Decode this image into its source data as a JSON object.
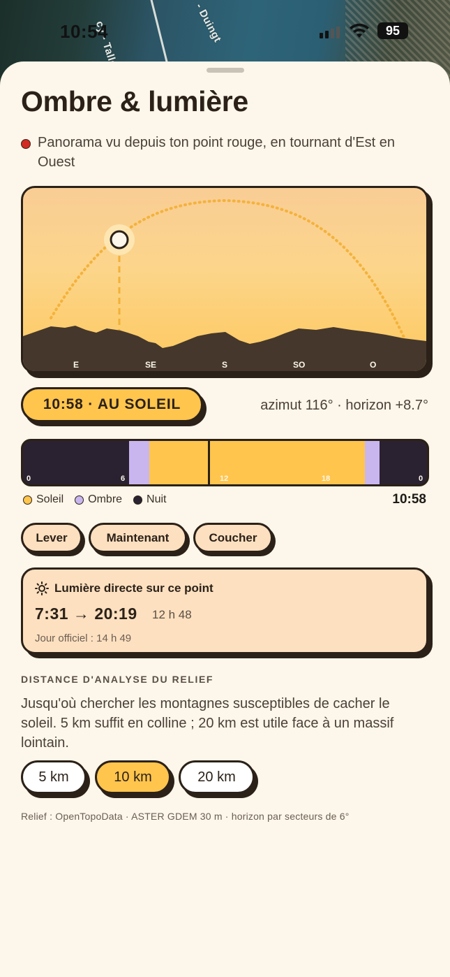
{
  "status_bar": {
    "time": "10:54",
    "battery": "95"
  },
  "map": {
    "road_labels": [
      "cy - Talloir",
      "- Duingt"
    ]
  },
  "sheet": {
    "title": "Ombre & lumière",
    "subtitle": "Panorama vu depuis ton point rouge, en tournant d'Est en Ouest"
  },
  "panorama": {
    "compass": [
      "E",
      "SE",
      "S",
      "SO",
      "O"
    ],
    "sun_azimuth_deg": 116
  },
  "current": {
    "status_label": "10:58 · AU SOLEIL",
    "azimut_text": "azimut 116° · horizon +8.7°"
  },
  "day_timeline": {
    "ticks": [
      "0",
      "6",
      "12",
      "18",
      "0"
    ],
    "segments": [
      {
        "kind": "nuit",
        "from_h": 0,
        "to_h": 6.3
      },
      {
        "kind": "ombre",
        "from_h": 6.3,
        "to_h": 7.5
      },
      {
        "kind": "soleil",
        "from_h": 7.5,
        "to_h": 20.3
      },
      {
        "kind": "ombre",
        "from_h": 20.3,
        "to_h": 21.2
      },
      {
        "kind": "nuit",
        "from_h": 21.2,
        "to_h": 24
      }
    ],
    "now_h": 10.97,
    "colors": {
      "soleil": "#ffc54d",
      "ombre": "#c9b6ef",
      "nuit": "#2a2230"
    }
  },
  "legend": {
    "sun": "Soleil",
    "shade": "Ombre",
    "night": "Nuit",
    "time": "10:58"
  },
  "quick_buttons": {
    "sunrise": "Lever",
    "now": "Maintenant",
    "sunset": "Coucher"
  },
  "light_card": {
    "title": "Lumière directe sur ce point",
    "times": "7:31 → 20:19",
    "duration": "12 h 48",
    "official": "Jour officiel : 14 h 49"
  },
  "relief": {
    "section_title": "DISTANCE D'ANALYSE DU RELIEF",
    "description": "Jusqu'où chercher les montagnes susceptibles de cacher le soleil. 5 km suffit en colline ; 20 km est utile face à un massif lointain.",
    "options": [
      "5 km",
      "10 km",
      "20 km"
    ],
    "selected": "10 km"
  },
  "footer": "Relief : OpenTopoData · ASTER GDEM 30 m · horizon par secteurs de 6°",
  "colors": {
    "accent": "#ffc54d",
    "ink": "#2b2118",
    "sheet": "#fdf6ea",
    "card": "#fde0c0",
    "sun_marker_red": "#d12b23"
  }
}
